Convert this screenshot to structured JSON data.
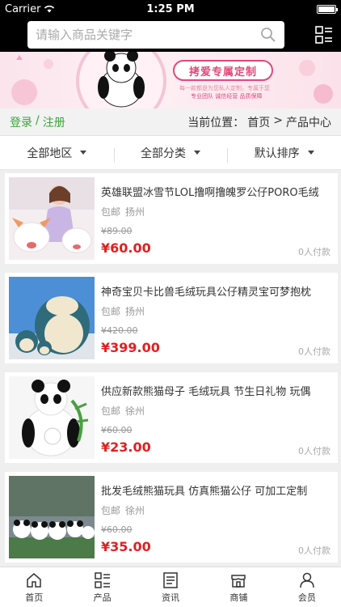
{
  "status": {
    "carrier": "Carrier",
    "time": "1:25 PM"
  },
  "search": {
    "placeholder": "请输入商品关键字"
  },
  "banner": {
    "title": "拷爱专属定制",
    "subtitle": "每一款都是为您私人定制，专属于您",
    "tags": "专业团队 诚信经营 品质保障"
  },
  "auth": {
    "login": "登录",
    "separator": "/",
    "register": "注册"
  },
  "breadcrumb": {
    "prefix": "当前位置：",
    "home": "首页",
    "arrow": ">",
    "current": "产品中心"
  },
  "filters": [
    {
      "label": "全部地区"
    },
    {
      "label": "全部分类"
    },
    {
      "label": "默认排序"
    }
  ],
  "products": [
    {
      "name": "英雄联盟冰雪节LOL撸啊撸魄罗公仔PORO毛绒",
      "shipping": "包邮",
      "city": "扬州",
      "old_price": "¥89.00",
      "price": "¥60.00",
      "paid": "0人付款"
    },
    {
      "name": "神奇宝贝卡比兽毛绒玩具公仔精灵宝可梦抱枕",
      "shipping": "包邮",
      "city": "扬州",
      "old_price": "¥420.00",
      "price": "¥399.00",
      "paid": "0人付款"
    },
    {
      "name": "供应新款熊猫母子 毛绒玩具 节生日礼物 玩偶",
      "shipping": "包邮",
      "city": "徐州",
      "old_price": "¥60.00",
      "price": "¥23.00",
      "paid": "0人付款"
    },
    {
      "name": "批发毛绒熊猫玩具 仿真熊猫公仔 可加工定制",
      "shipping": "包邮",
      "city": "徐州",
      "old_price": "¥60.00",
      "price": "¥35.00",
      "paid": "0人付款"
    }
  ],
  "tabs": [
    {
      "label": "首页",
      "icon": "home-icon"
    },
    {
      "label": "产品",
      "icon": "grid-list-icon"
    },
    {
      "label": "资讯",
      "icon": "news-icon"
    },
    {
      "label": "商铺",
      "icon": "store-icon"
    },
    {
      "label": "会员",
      "icon": "user-icon"
    }
  ]
}
